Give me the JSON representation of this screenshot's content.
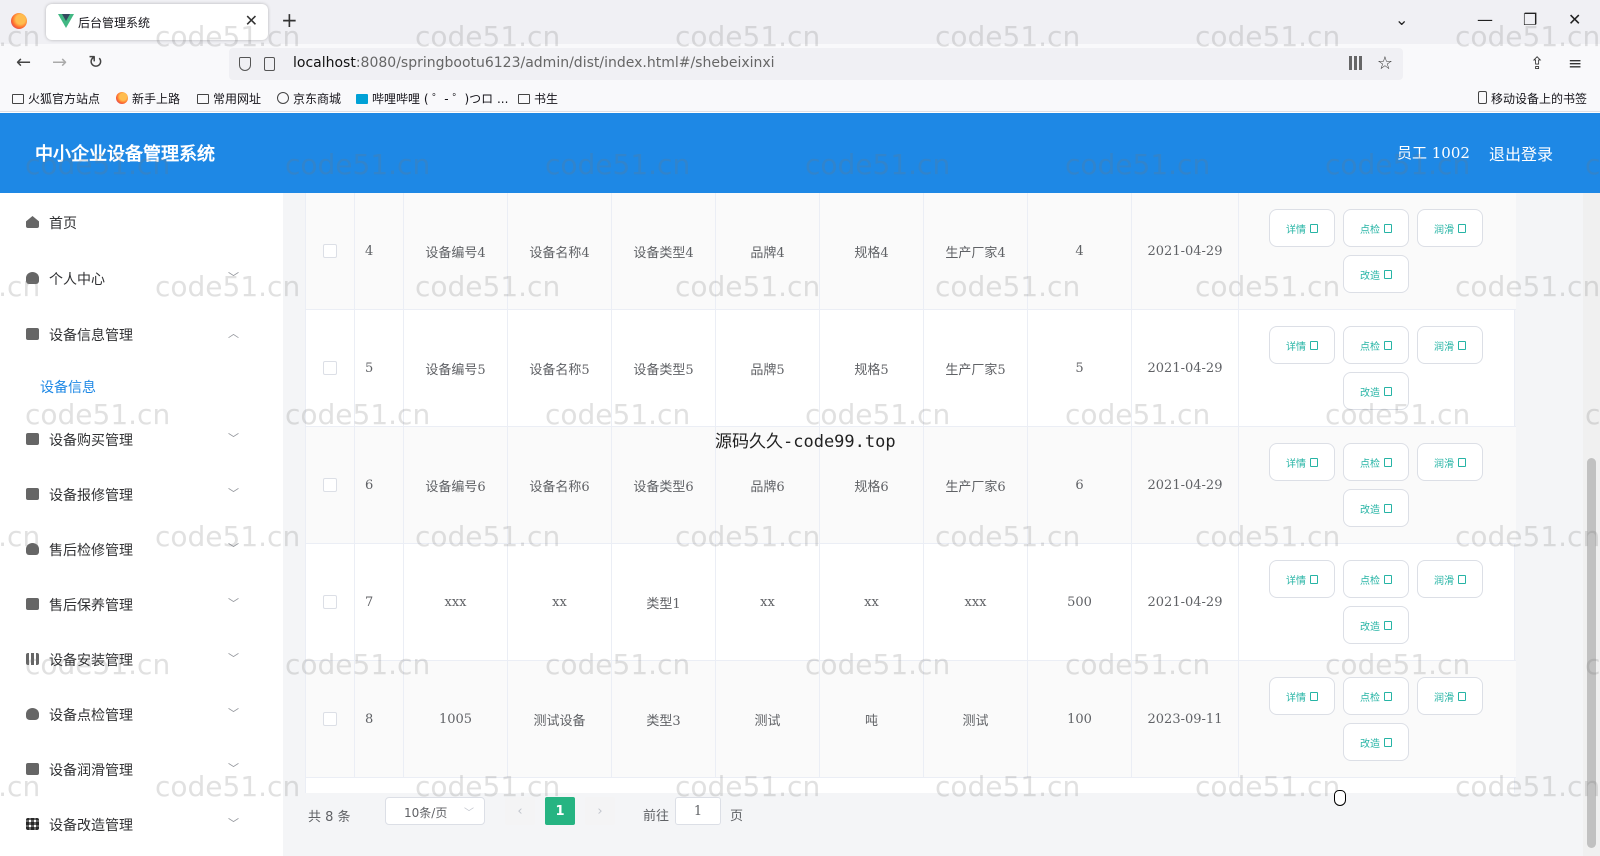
{
  "browser": {
    "tab_title": "后台管理系统",
    "tab_close": "✕",
    "new_tab": "+",
    "url_host": "localhost",
    "url_rest": ":8080/springbootu6123/admin/dist/index.html#/shebeixinxi",
    "bookmarks": [
      "火狐官方站点",
      "新手上路",
      "常用网址",
      "京东商城",
      "哔哩哔哩 ( ゜- ゜)つロ ...",
      "书生"
    ],
    "mobile_bookmarks": "移动设备上的书签"
  },
  "header": {
    "title": "中小企业设备管理系统",
    "user": "员工 1002",
    "logout": "退出登录"
  },
  "sidebar": {
    "items": [
      {
        "label": "首页",
        "icon": "home-icon"
      },
      {
        "label": "个人中心",
        "icon": "user-icon"
      },
      {
        "label": "设备信息管理",
        "icon": "briefcase-icon",
        "expanded": true
      },
      {
        "label": "设备购买管理",
        "icon": "cart-icon"
      },
      {
        "label": "设备报修管理",
        "icon": "chart-icon"
      },
      {
        "label": "售后检修管理",
        "icon": "user-icon"
      },
      {
        "label": "售后保养管理",
        "icon": "clipboard-icon"
      },
      {
        "label": "设备安装管理",
        "icon": "bar-chart-icon"
      },
      {
        "label": "设备点检管理",
        "icon": "bulb-icon"
      },
      {
        "label": "设备润滑管理",
        "icon": "monitor-icon"
      },
      {
        "label": "设备改造管理",
        "icon": "grid-icon"
      }
    ],
    "sub_item": "设备信息"
  },
  "table": {
    "rows": [
      {
        "idx": "4",
        "code": "设备编号4",
        "name": "设备名称4",
        "type": "设备类型4",
        "brand": "品牌4",
        "spec": "规格4",
        "maker": "生产厂家4",
        "qty": "4",
        "date": "2021-04-29"
      },
      {
        "idx": "5",
        "code": "设备编号5",
        "name": "设备名称5",
        "type": "设备类型5",
        "brand": "品牌5",
        "spec": "规格5",
        "maker": "生产厂家5",
        "qty": "5",
        "date": "2021-04-29"
      },
      {
        "idx": "6",
        "code": "设备编号6",
        "name": "设备名称6",
        "type": "设备类型6",
        "brand": "品牌6",
        "spec": "规格6",
        "maker": "生产厂家6",
        "qty": "6",
        "date": "2021-04-29"
      },
      {
        "idx": "7",
        "code": "xxx",
        "name": "xx",
        "type": "类型1",
        "brand": "xx",
        "spec": "xx",
        "maker": "xxx",
        "qty": "500",
        "date": "2021-04-29"
      },
      {
        "idx": "8",
        "code": "1005",
        "name": "测试设备",
        "type": "类型3",
        "brand": "测试",
        "spec": "吨",
        "maker": "测试",
        "qty": "100",
        "date": "2023-09-11"
      }
    ],
    "actions": {
      "detail": "详情",
      "inspect": "点检",
      "lubricate": "润滑",
      "modify": "改造"
    }
  },
  "pagination": {
    "total": "共 8 条",
    "page_size": "10条/页",
    "prev": "‹",
    "current": "1",
    "next": "›",
    "goto_label": "前往",
    "goto_value": "1",
    "page_label": "页"
  },
  "overlay_text": "源码久久-code99.top",
  "watermark": "code51.cn"
}
